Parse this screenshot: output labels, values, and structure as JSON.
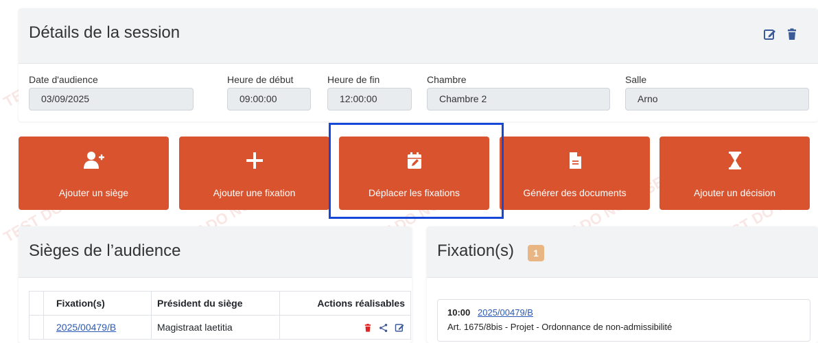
{
  "session": {
    "title": "Détails de la session",
    "icons": [
      "edit-icon",
      "trash-icon"
    ],
    "fields": [
      {
        "label": "Date d'audience",
        "value": "03/09/2025"
      },
      {
        "label": "Heure de début",
        "value": "09:00:00"
      },
      {
        "label": "Heure de fin",
        "value": "12:00:00"
      },
      {
        "label": "Chambre",
        "value": "Chambre 2"
      },
      {
        "label": "Salle",
        "value": "Arno"
      }
    ]
  },
  "actions": [
    {
      "label": "Ajouter un siège",
      "icon": "add-user-icon"
    },
    {
      "label": "Ajouter une fixation",
      "icon": "plus-icon"
    },
    {
      "label": "Déplacer les fixations",
      "icon": "calendar-edit-icon"
    },
    {
      "label": "Générer des documents",
      "icon": "document-icon"
    },
    {
      "label": "Ajouter un décision",
      "icon": "hourglass-icon"
    }
  ],
  "sieges": {
    "title": "Sièges de l’audience",
    "columns": [
      "Fixation(s)",
      "Président du siège",
      "Actions réalisables"
    ],
    "rows": [
      {
        "fixation": "2025/00479/B",
        "president": "Magistraat laetitia"
      }
    ]
  },
  "fixations": {
    "title": "Fixation(s)",
    "count": "1",
    "items": [
      {
        "time": "10:00",
        "ref": "2025/00479/B",
        "description": "Art. 1675/8bis - Projet - Ordonnance de non-admissibilité"
      }
    ]
  },
  "watermark": "TEST DO NOT USE",
  "colors": {
    "accent": "#d9532e",
    "highlight": "#1548d8",
    "badge": "#e9b583",
    "link": "#2a59b6",
    "delete": "#e02424",
    "icon_blue": "#3d5a98"
  }
}
